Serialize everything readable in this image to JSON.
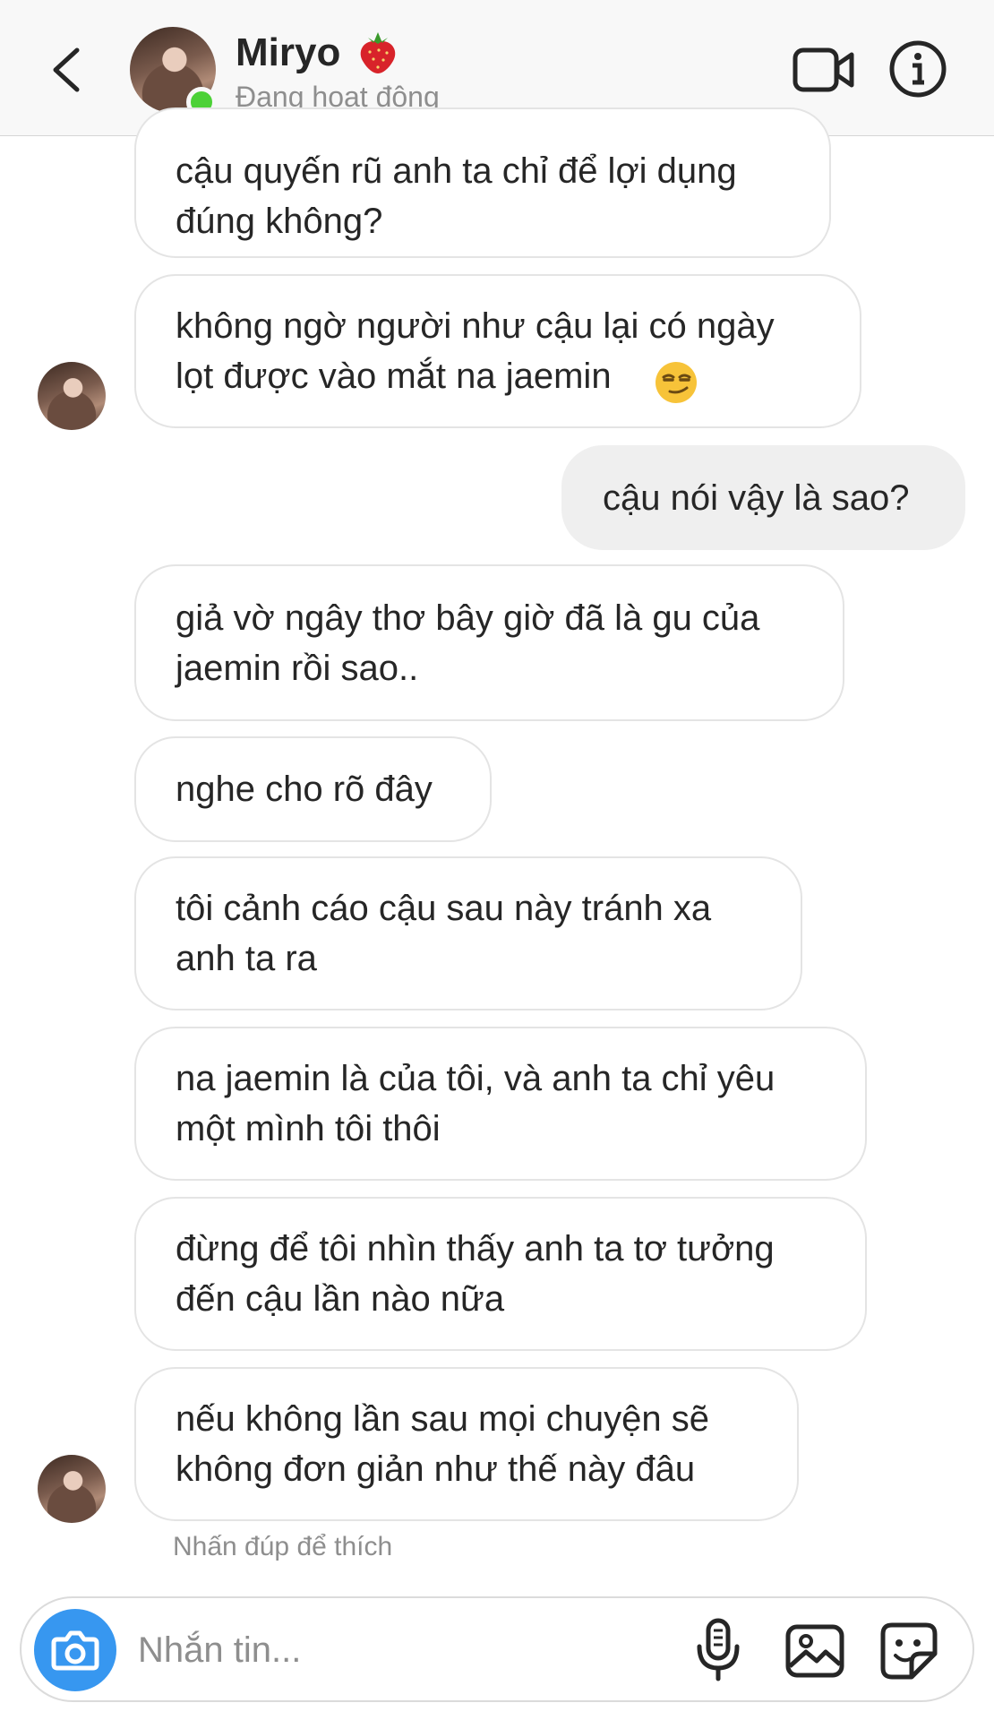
{
  "header": {
    "contact_name": "Miryo",
    "status": "Đang hoạt động"
  },
  "messages": [
    {
      "text": "cậu quyến rũ anh ta chỉ để lợi dụng\nđúng không?",
      "sender": "other"
    },
    {
      "text": "không ngờ người như cậu lại có ngày\nlọt được vào mắt na jaemin",
      "sender": "other",
      "emoji": "smirk-emoji"
    },
    {
      "text": "cậu nói vậy là sao?",
      "sender": "me"
    },
    {
      "text": "giả vờ ngây thơ bây giờ đã là gu của\njaemin rồi sao..",
      "sender": "other"
    },
    {
      "text": "nghe cho rõ đây",
      "sender": "other"
    },
    {
      "text": "tôi cảnh cáo cậu sau này tránh xa\nanh ta ra",
      "sender": "other"
    },
    {
      "text": "na jaemin là của tôi, và anh ta chỉ yêu\nmột mình tôi thôi",
      "sender": "other"
    },
    {
      "text": "đừng để tôi nhìn thấy anh ta tơ tưởng\nđến cậu lần nào nữa",
      "sender": "other"
    },
    {
      "text": "nếu không lần sau mọi chuyện sẽ\nkhông đơn giản như thế này đâu",
      "sender": "other"
    }
  ],
  "hint": "Nhấn đúp để thích",
  "composer": {
    "placeholder": "Nhắn tin..."
  },
  "icons": {
    "back": "chevron-left-icon",
    "video": "video-call-icon",
    "info": "info-icon",
    "camera": "camera-icon",
    "mic": "microphone-icon",
    "gallery": "gallery-icon",
    "sticker": "sticker-icon"
  },
  "colors": {
    "online": "#4cd137",
    "camera_button": "#3797f0",
    "sent_bubble": "#efefef",
    "received_border": "#e4e4e4"
  }
}
